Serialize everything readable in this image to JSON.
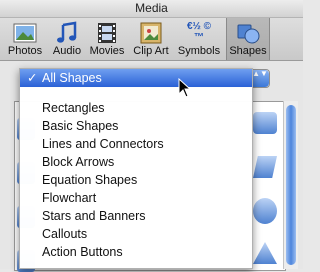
{
  "window": {
    "title": "Media"
  },
  "toolbar": {
    "items": [
      {
        "label": "Photos",
        "icon": "photos-icon"
      },
      {
        "label": "Audio",
        "icon": "audio-icon"
      },
      {
        "label": "Movies",
        "icon": "movies-icon"
      },
      {
        "label": "Clip Art",
        "icon": "clip-art-icon"
      },
      {
        "label": "Symbols",
        "icon": "symbols-icon",
        "glyph": "€½ ©™"
      },
      {
        "label": "Shapes",
        "icon": "shapes-icon"
      }
    ],
    "selected": "Shapes"
  },
  "category_popup": {
    "selected_label": "All Shapes",
    "check": "✓",
    "arrows": "▲▼"
  },
  "menu": {
    "items": [
      "Rectangles",
      "Basic Shapes",
      "Lines and Connectors",
      "Block Arrows",
      "Equation Shapes",
      "Flowchart",
      "Stars and Banners",
      "Callouts",
      "Action Buttons"
    ]
  },
  "colors": {
    "selection_blue": "#2a61d6",
    "shape_fill": "#4f82d1"
  }
}
